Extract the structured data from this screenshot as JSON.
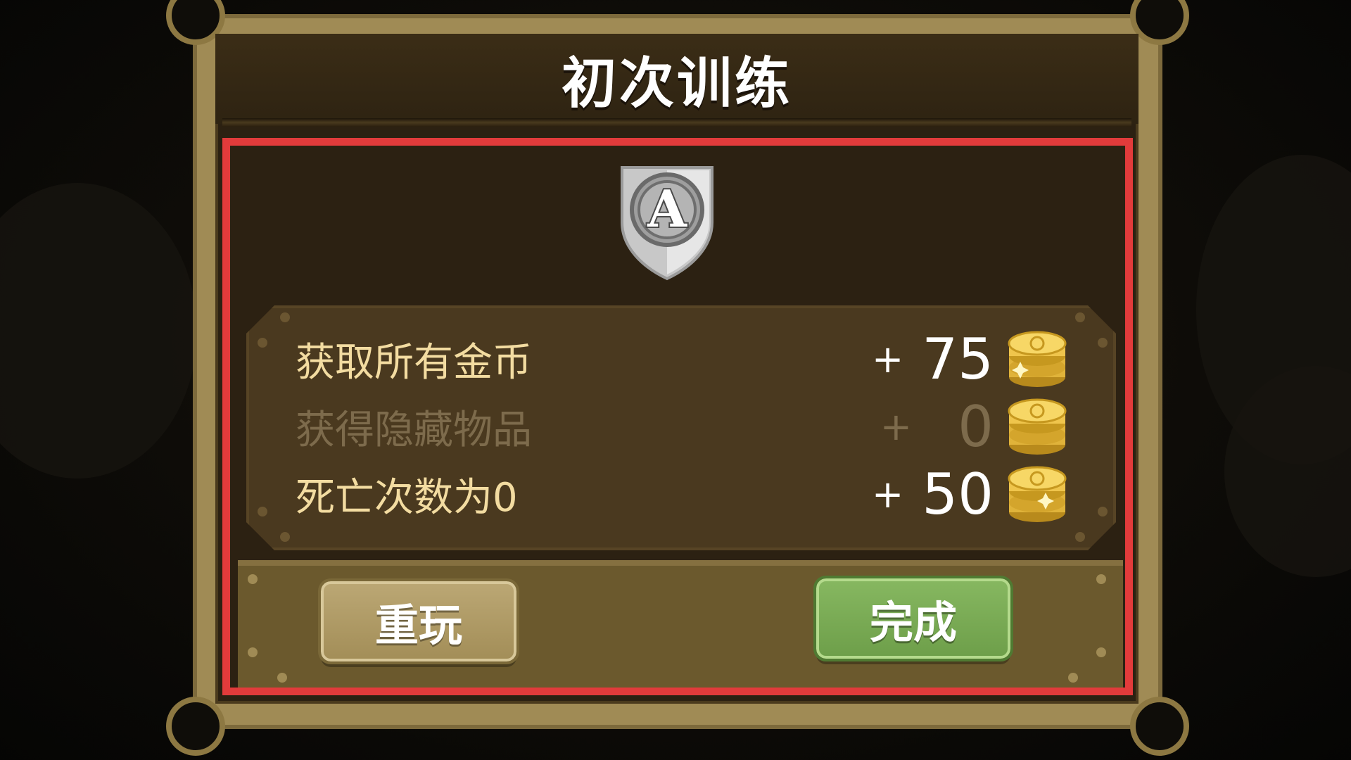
{
  "dialog": {
    "title": "初次训练"
  },
  "rewards": [
    {
      "label": "获取所有金币",
      "plus": "+",
      "amount": "75",
      "active": true
    },
    {
      "label": "获得隐藏物品",
      "plus": "+",
      "amount": "0",
      "active": false
    },
    {
      "label": "死亡次数为0",
      "plus": "+",
      "amount": "50",
      "active": true
    }
  ],
  "buttons": {
    "replay_label": "重玩",
    "done_label": "完成"
  },
  "icons": {
    "badge": "shield-letter-a-icon",
    "reward": "gold-coins-icon"
  },
  "badge_letter": "A",
  "colors": {
    "highlight": "#e23b3b",
    "replay_button": "#a38e58",
    "done_button": "#6e9f4a",
    "frame": "#a08b55"
  }
}
